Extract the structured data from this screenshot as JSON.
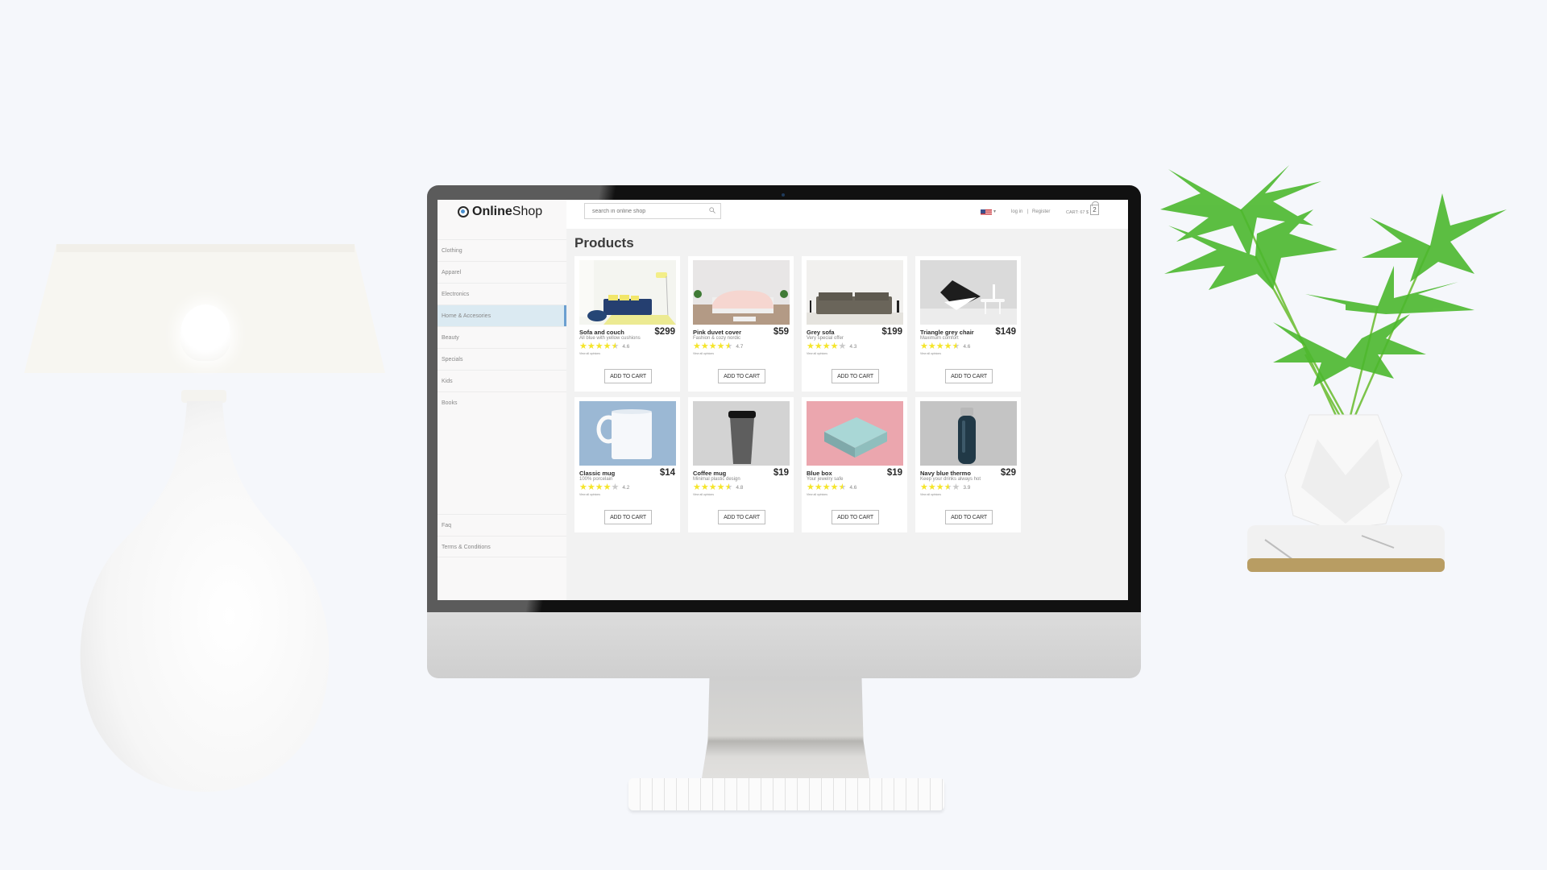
{
  "header": {
    "logo_bold": "Online",
    "logo_light": "Shop",
    "search_placeholder": "search in online shop",
    "login_label": "log in",
    "separator": "|",
    "register_label": "Register",
    "cart_total": "CART: 67 $",
    "cart_count": "2",
    "language_flag": "us-flag-icon"
  },
  "sidebar": {
    "items": [
      {
        "label": "Clothing",
        "active": false
      },
      {
        "label": "Apparel",
        "active": false
      },
      {
        "label": "Electronics",
        "active": false
      },
      {
        "label": "Home & Accesories",
        "active": true
      },
      {
        "label": "Beauty",
        "active": false
      },
      {
        "label": "Specials",
        "active": false
      },
      {
        "label": "Kids",
        "active": false
      },
      {
        "label": "Books",
        "active": false
      }
    ],
    "bottom_items": [
      {
        "label": "Faq"
      },
      {
        "label": "Terms & Conditions"
      }
    ]
  },
  "main": {
    "title": "Products",
    "add_to_cart_label": "ADD TO CART",
    "opinions_label": "View all opinions",
    "products": [
      {
        "name": "Sofa and couch",
        "description": "All blue with yellow cushions",
        "price": "$299",
        "rating": 4.6,
        "image": "sofa-image"
      },
      {
        "name": "Pink duvet cover",
        "description": "Fashion & cozy nordic",
        "price": "$59",
        "rating": 4.7,
        "image": "bed-image"
      },
      {
        "name": "Grey sofa",
        "description": "Very special offer",
        "price": "$199",
        "rating": 4.3,
        "image": "grey-sofa-image"
      },
      {
        "name": "Triangle grey chair",
        "description": "Maximum comfort",
        "price": "$149",
        "rating": 4.6,
        "image": "chair-image"
      },
      {
        "name": "Classic mug",
        "description": "100% porcelain",
        "price": "$14",
        "rating": 4.2,
        "image": "mug-image"
      },
      {
        "name": "Coffee mug",
        "description": "Minimal plastic design",
        "price": "$19",
        "rating": 4.8,
        "image": "coffee-cup-image"
      },
      {
        "name": "Blue box",
        "description": "Your jewelry safe",
        "price": "$19",
        "rating": 4.6,
        "image": "box-image"
      },
      {
        "name": "Navy blue thermo",
        "description": "Keep your drinks always hot",
        "price": "$29",
        "rating": 3.9,
        "image": "thermo-image"
      }
    ]
  },
  "colors": {
    "background": "#f5f7fb",
    "accent": "#6b9fd0",
    "active_item_bg": "#dbeaf2",
    "star": "#f5e52a"
  }
}
